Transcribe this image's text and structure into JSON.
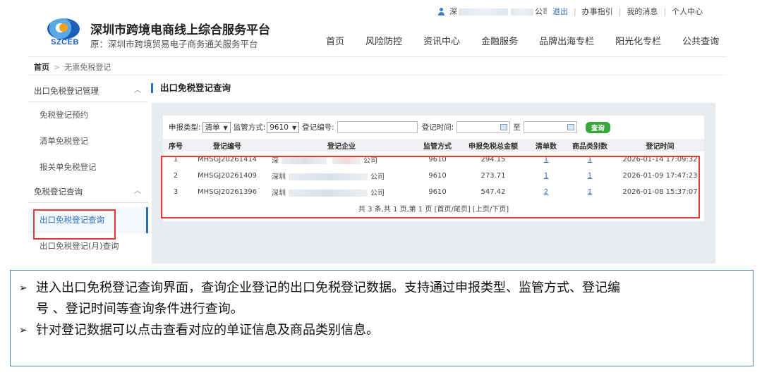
{
  "topbar": {
    "company_prefix": "深",
    "company_suffix": "公司",
    "links": [
      "退出",
      "办事指引",
      "我的消息",
      "个人中心"
    ]
  },
  "header": {
    "logo_abbr": "SZCEB",
    "title": "深圳市跨境电商线上综合服务平台",
    "subtitle": "原：深圳市跨境贸易电子商务通关服务平台"
  },
  "nav": [
    "首页",
    "风险防控",
    "资讯中心",
    "金融服务",
    "品牌出海专栏",
    "阳光化专栏",
    "公共查询"
  ],
  "breadcrumb": {
    "home": "首页",
    "current": "无票免税登记"
  },
  "sidebar": {
    "group1": "出口免税登记管理",
    "group1_items": [
      "免税登记预约",
      "清单免税登记",
      "报关单免税登记"
    ],
    "group2": "免税登记查询",
    "group2_items": [
      "出口免税登记查询",
      "出口免税登记(月)查询"
    ]
  },
  "content": {
    "title": "出口免税登记查询",
    "query": {
      "type_label": "申报类型:",
      "type_value": "清单",
      "mode_label": "监管方式:",
      "mode_value": "9610",
      "reg_no_label": "登记编号:",
      "time_label": "登记时间:",
      "to_label": "至",
      "search_button": "查询"
    },
    "columns": [
      "序号",
      "登记编号",
      "登记企业",
      "监管方式",
      "申报免税总金额",
      "清单数",
      "商品类别数",
      "登记时间"
    ],
    "rows": [
      {
        "idx": "1",
        "no": "MHSGJ20261414",
        "ent_a": "深",
        "ent_b": "公司",
        "mode": "9610",
        "amount": "294.15",
        "count": "1",
        "cat": "1",
        "time": "2026-01-14 17:09:32"
      },
      {
        "idx": "2",
        "no": "MHSGJ20261409",
        "ent_a": "深圳",
        "ent_b": "公司",
        "mode": "9610",
        "amount": "273.71",
        "count": "1",
        "cat": "1",
        "time": "2026-01-09 17:47:23"
      },
      {
        "idx": "3",
        "no": "MHSGJ20261396",
        "ent_a": "深圳",
        "ent_b": "公司",
        "mode": "9610",
        "amount": "547.42",
        "count": "2",
        "cat": "1",
        "time": "2026-01-08 15:37:07"
      }
    ],
    "pager": "共 3 条,共 1 页,第 1 页 [首页/尾页] [上页/下页]"
  },
  "notes": {
    "line1": "进入出口免税登记查询界面，查询企业登记的出口免税登记数据。支持通过申报类型、监管方式、登记编",
    "line1_cont": "号 、登记时间等查询条件进行查询。",
    "line2": "针对登记数据可以点击查看对应的单证信息及商品类别信息。"
  }
}
